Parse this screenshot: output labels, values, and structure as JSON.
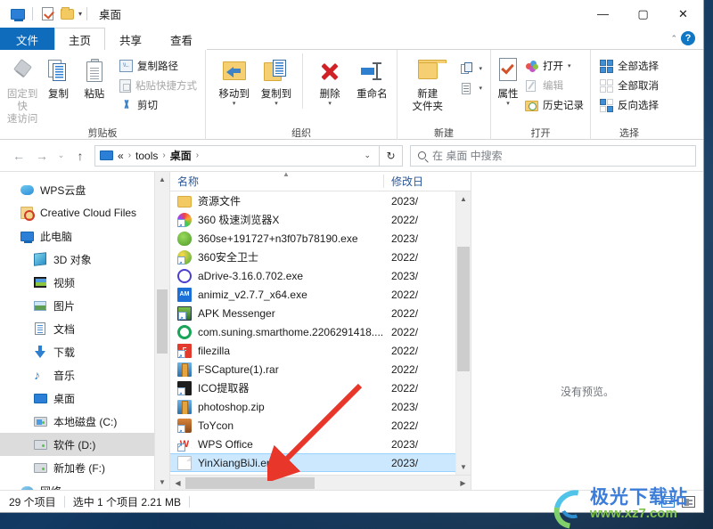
{
  "window": {
    "title": "桌面",
    "quick_access": [
      "monitor-icon",
      "properties-icon",
      "folder-icon"
    ],
    "controls": {
      "minimize": "—",
      "maximize": "▢",
      "close": "✕",
      "collapse_ribbon": "⌃",
      "help": "?"
    }
  },
  "tabs": [
    {
      "label": "文件",
      "type": "file"
    },
    {
      "label": "主页",
      "type": "active"
    },
    {
      "label": "共享",
      "type": "normal"
    },
    {
      "label": "查看",
      "type": "normal"
    }
  ],
  "ribbon": {
    "groups": [
      {
        "label": "剪贴板",
        "big_buttons": [
          {
            "label_line1": "固定到快",
            "label_line2": "速访问",
            "icon": "pin-icon",
            "disabled": true
          },
          {
            "label_line1": "复制",
            "label_line2": "",
            "icon": "copy-icon",
            "disabled": false
          },
          {
            "label_line1": "粘贴",
            "label_line2": "",
            "icon": "paste-icon",
            "disabled": false
          }
        ],
        "small_buttons": [
          {
            "label": "复制路径",
            "icon": "copy-path-icon",
            "disabled": false
          },
          {
            "label": "粘贴快捷方式",
            "icon": "paste-shortcut-icon",
            "disabled": true
          },
          {
            "label": "剪切",
            "icon": "cut-icon",
            "disabled": false
          }
        ]
      },
      {
        "label": "组织",
        "big_buttons": [
          {
            "label_line1": "移动到",
            "label_line2": "",
            "icon": "move-to-icon",
            "has_caret": true
          },
          {
            "label_line1": "复制到",
            "label_line2": "",
            "icon": "copy-to-icon",
            "has_caret": true
          },
          {
            "label_line1": "删除",
            "label_line2": "",
            "icon": "delete-icon",
            "has_caret": true
          },
          {
            "label_line1": "重命名",
            "label_line2": "",
            "icon": "rename-icon",
            "has_caret": false
          }
        ],
        "small_buttons": []
      },
      {
        "label": "新建",
        "big_buttons": [
          {
            "label_line1": "新建",
            "label_line2": "文件夹",
            "icon": "new-folder-icon",
            "has_caret": false
          }
        ],
        "small_buttons": [
          {
            "label": "",
            "icon": "new-item-icon",
            "has_caret": true
          },
          {
            "label": "",
            "icon": "easy-access-icon",
            "has_caret": true
          }
        ]
      },
      {
        "label": "打开",
        "big_buttons": [
          {
            "label_line1": "属性",
            "label_line2": "",
            "icon": "properties-icon",
            "has_caret": true
          }
        ],
        "small_buttons": [
          {
            "label": "打开",
            "icon": "open-icon",
            "has_caret": true
          },
          {
            "label": "编辑",
            "icon": "edit-icon",
            "disabled": true
          },
          {
            "label": "历史记录",
            "icon": "history-icon"
          }
        ]
      },
      {
        "label": "选择",
        "big_buttons": [],
        "small_buttons": [
          {
            "label": "全部选择",
            "icon": "select-all-icon"
          },
          {
            "label": "全部取消",
            "icon": "select-none-icon"
          },
          {
            "label": "反向选择",
            "icon": "invert-selection-icon"
          }
        ]
      }
    ]
  },
  "address_bar": {
    "back": "←",
    "forward": "→",
    "recent": "⌄",
    "up": "↑",
    "breadcrumbs": [
      "«",
      "tools",
      "桌面"
    ],
    "dropdown": "⌄",
    "refresh": "↻"
  },
  "search": {
    "placeholder": "在 桌面 中搜索"
  },
  "nav_pane": {
    "items": [
      {
        "label": "WPS云盘",
        "icon": "wps-cloud-icon",
        "level": 1,
        "selected": false
      },
      {
        "label": "Creative Cloud Files",
        "icon": "creative-cloud-icon",
        "level": 1,
        "selected": false
      },
      {
        "label": "此电脑",
        "icon": "this-pc-icon",
        "level": 1,
        "selected": false
      },
      {
        "label": "3D 对象",
        "icon": "3d-objects-icon",
        "level": 2,
        "selected": false
      },
      {
        "label": "视频",
        "icon": "videos-icon",
        "level": 2,
        "selected": false
      },
      {
        "label": "图片",
        "icon": "pictures-icon",
        "level": 2,
        "selected": false
      },
      {
        "label": "文档",
        "icon": "documents-icon",
        "level": 2,
        "selected": false
      },
      {
        "label": "下载",
        "icon": "downloads-icon",
        "level": 2,
        "selected": false
      },
      {
        "label": "音乐",
        "icon": "music-icon",
        "level": 2,
        "selected": false
      },
      {
        "label": "桌面",
        "icon": "desktop-icon",
        "level": 2,
        "selected": false
      },
      {
        "label": "本地磁盘 (C:)",
        "icon": "windows-drive-icon",
        "level": 2,
        "selected": false
      },
      {
        "label": "软件 (D:)",
        "icon": "drive-icon",
        "level": 2,
        "selected": true
      },
      {
        "label": "新加卷 (F:)",
        "icon": "drive-icon",
        "level": 2,
        "selected": false
      },
      {
        "label": "网络",
        "icon": "network-icon",
        "level": 1,
        "selected": false
      }
    ]
  },
  "file_list": {
    "columns": [
      "名称",
      "修改日"
    ],
    "rows": [
      {
        "name": "资源文件",
        "date": "2023/",
        "icon": "folder",
        "selected": false,
        "shortcut": false
      },
      {
        "name": "360 极速浏览器X",
        "date": "2022/",
        "icon": "360x",
        "selected": false,
        "shortcut": true
      },
      {
        "name": "360se+191727+n3f07b78190.exe",
        "date": "2023/",
        "icon": "360se",
        "selected": false,
        "shortcut": false
      },
      {
        "name": "360安全卫士",
        "date": "2022/",
        "icon": "360sec",
        "selected": false,
        "shortcut": true
      },
      {
        "name": "aDrive-3.16.0.702.exe",
        "date": "2023/",
        "icon": "adrive",
        "selected": false,
        "shortcut": false
      },
      {
        "name": "animiz_v2.7.7_x64.exe",
        "date": "2022/",
        "icon": "animiz",
        "selected": false,
        "shortcut": false
      },
      {
        "name": "APK Messenger",
        "date": "2022/",
        "icon": "apk",
        "selected": false,
        "shortcut": true
      },
      {
        "name": "com.suning.smarthome.2206291418....",
        "date": "2022/",
        "icon": "suning",
        "selected": false,
        "shortcut": false
      },
      {
        "name": "filezilla",
        "date": "2022/",
        "icon": "filezilla",
        "selected": false,
        "shortcut": true
      },
      {
        "name": "FSCapture(1).rar",
        "date": "2022/",
        "icon": "rar",
        "selected": false,
        "shortcut": false
      },
      {
        "name": "ICO提取器",
        "date": "2022/",
        "icon": "ico",
        "selected": false,
        "shortcut": true
      },
      {
        "name": "photoshop.zip",
        "date": "2023/",
        "icon": "rar",
        "selected": false,
        "shortcut": false
      },
      {
        "name": "ToYcon",
        "date": "2022/",
        "icon": "toycon",
        "selected": false,
        "shortcut": true
      },
      {
        "name": "WPS Office",
        "date": "2023/",
        "icon": "wps",
        "selected": false,
        "shortcut": true
      },
      {
        "name": "YinXiangBiJi.enex",
        "date": "2023/",
        "icon": "enex",
        "selected": true,
        "shortcut": false
      }
    ]
  },
  "preview_pane": {
    "message": "没有预览。"
  },
  "status_bar": {
    "item_count": "29 个项目",
    "selection": "选中 1 个项目  2.21 MB",
    "view_buttons": [
      "details-view-icon",
      "tiles-view-icon"
    ]
  },
  "watermark": {
    "cn": "极光下载站",
    "en": "www.xz7.com"
  },
  "colors": {
    "accent": "#0f6cbd",
    "selection": "#cce8ff",
    "column_header_text": "#2b579a",
    "arrow_annotation": "#e8362a"
  }
}
